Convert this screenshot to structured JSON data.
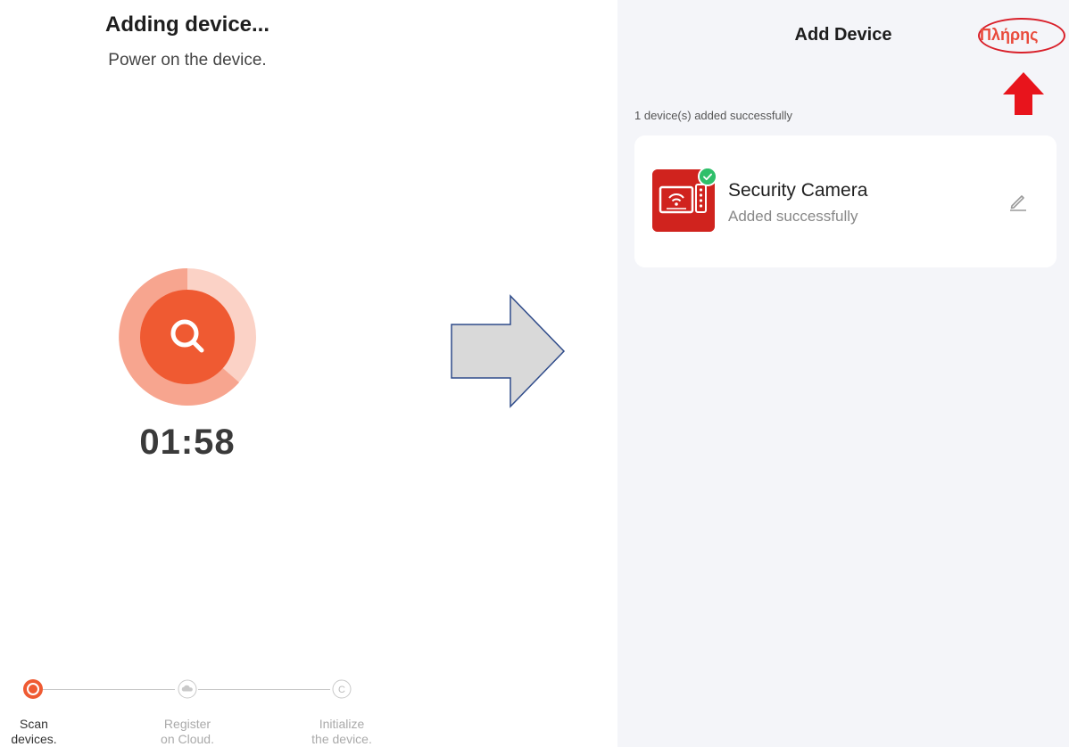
{
  "left_screen": {
    "title": "Adding device...",
    "subtitle": "Power on the device.",
    "timer": "01:58",
    "steps": [
      {
        "line1": "Scan",
        "line2": "devices.",
        "state": "active"
      },
      {
        "line1": "Register",
        "line2": "on Cloud.",
        "state": "inactive"
      },
      {
        "line1": "Initialize",
        "line2": "the device.",
        "state": "inactive"
      }
    ],
    "colors": {
      "accent": "#ef5a32",
      "accent_light": "#f7a58f",
      "inactive": "#c9c9c9"
    }
  },
  "right_screen": {
    "title": "Add Device",
    "done_label": "Πλήρης",
    "added_count": "1 device(s) added successfully",
    "device": {
      "name": "Security Camera",
      "status": "Added successfully",
      "icon": "camera-monitor-icon"
    },
    "colors": {
      "done": "#e94b3c",
      "highlight": "#d9202a",
      "success": "#2fbf6a",
      "background": "#f4f5f9"
    }
  },
  "transition_arrow": {
    "icon": "right-arrow-icon",
    "fill": "#d9d9d9",
    "stroke": "#2f4b8a"
  }
}
